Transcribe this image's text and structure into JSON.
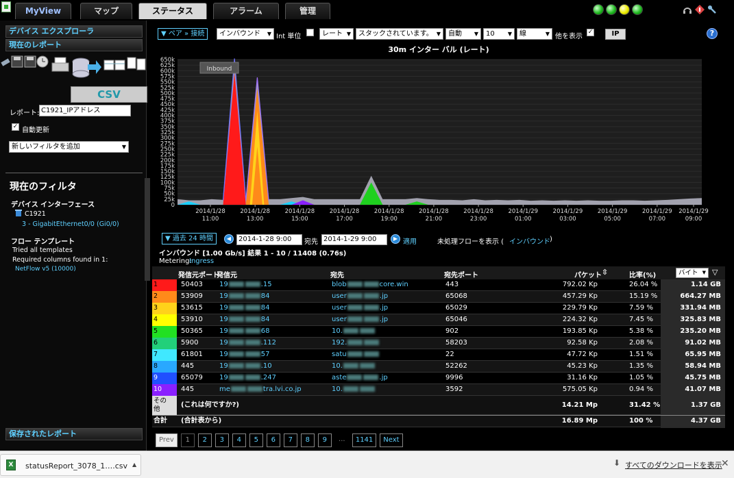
{
  "tabs": [
    {
      "label": "MyView"
    },
    {
      "label": "マップ"
    },
    {
      "label": "ステータス"
    },
    {
      "label": "アラーム"
    },
    {
      "label": "管理"
    }
  ],
  "sidebar": {
    "explorer_title": "デバイス エクスプローラ",
    "current_report_title": "現在のレポート",
    "csv_label": "CSV",
    "report_label": "レポート:",
    "report_value": "C1921_IPアドレス",
    "auto_update_label": "自動更新",
    "add_filter_label": "新しいフィルタを追加",
    "current_filter_title": "現在のフィルタ",
    "device_interface_title": "デバイス インターフェース",
    "device_name": "C1921",
    "interface_name": "3 - GigabitEthernet0/0 (Gi0/0)",
    "flow_template_title": "フロー テンプレート",
    "tried_templates": "Tried all templates",
    "required_columns": "Required columns found in 1:",
    "netflow_link": "NetFlow v5 (10000)",
    "saved_reports_title": "保存されたレポート"
  },
  "toolbar": {
    "pair_connection": "▼ ペア » 接続",
    "direction": "インバウンド",
    "int_unit_label": "Int 単位",
    "rate": "レート",
    "stacked": "スタックされています。",
    "auto": "自動",
    "count": "10",
    "line": "線",
    "show_others_label": "他を表示",
    "ip_label": "IP",
    "help_label": "?"
  },
  "chart_title": "30m インター バル (レート)",
  "chart_data": {
    "type": "area",
    "legend_badge": "Inbound",
    "ylim": [
      0,
      650000
    ],
    "y_ticks": [
      "0",
      "25k",
      "50k",
      "75k",
      "100k",
      "125k",
      "150k",
      "175k",
      "200k",
      "225k",
      "250k",
      "275k",
      "300k",
      "325k",
      "350k",
      "375k",
      "400k",
      "425k",
      "450k",
      "475k",
      "500k",
      "525k",
      "550k",
      "575k",
      "600k",
      "625k",
      "650k"
    ],
    "x_ticks": [
      {
        "date": "2014/1/28",
        "time": "11:00"
      },
      {
        "date": "2014/1/28",
        "time": "13:00"
      },
      {
        "date": "2014/1/28",
        "time": "15:00"
      },
      {
        "date": "2014/1/28",
        "time": "17:00"
      },
      {
        "date": "2014/1/28",
        "time": "19:00"
      },
      {
        "date": "2014/1/28",
        "time": "21:00"
      },
      {
        "date": "2014/1/28",
        "time": "23:00"
      },
      {
        "date": "2014/1/29",
        "time": "01:00"
      },
      {
        "date": "2014/1/29",
        "time": "03:00"
      },
      {
        "date": "2014/1/29",
        "time": "05:00"
      },
      {
        "date": "2014/1/29",
        "time": "07:00"
      },
      {
        "date": "2014/1/29",
        "time": "09:00"
      }
    ],
    "x": [
      "10:30",
      "11:00",
      "11:30",
      "12:00",
      "12:30",
      "13:00",
      "13:30",
      "14:00",
      "14:30",
      "15:00",
      "15:30",
      "16:00",
      "16:30",
      "17:00",
      "17:30",
      "18:00",
      "18:30",
      "19:00",
      "19:30",
      "20:00",
      "20:30",
      "21:00",
      "21:30",
      "22:00",
      "22:30",
      "23:00",
      "23:30",
      "00:00",
      "00:30",
      "01:00",
      "01:30",
      "02:00",
      "02:30",
      "03:00",
      "03:30",
      "04:00",
      "04:30",
      "05:00",
      "05:30",
      "06:00",
      "06:30",
      "07:00",
      "07:30",
      "08:00",
      "08:30",
      "09:00",
      "09:30"
    ],
    "series": [
      {
        "color": "#ff1a1a",
        "values": [
          0,
          0,
          0,
          0,
          0,
          590000,
          0,
          0,
          0,
          0,
          0,
          0,
          0,
          0,
          0,
          0,
          0,
          0,
          0,
          0,
          0,
          0,
          0,
          0,
          0,
          0,
          0,
          0,
          0,
          0,
          0,
          0,
          0,
          0,
          0,
          0,
          0,
          0,
          0,
          0,
          0,
          0,
          0,
          0,
          0,
          0,
          0
        ]
      },
      {
        "color": "#ff8a1a",
        "values": [
          0,
          0,
          0,
          0,
          0,
          0,
          0,
          520000,
          0,
          0,
          0,
          0,
          0,
          0,
          0,
          0,
          0,
          0,
          0,
          0,
          0,
          0,
          0,
          0,
          0,
          0,
          0,
          0,
          0,
          0,
          0,
          0,
          0,
          0,
          0,
          0,
          0,
          0,
          0,
          0,
          0,
          0,
          0,
          0,
          0,
          0,
          0
        ]
      },
      {
        "color": "#ffd21a",
        "values": [
          0,
          0,
          0,
          0,
          0,
          0,
          0,
          0,
          0,
          0,
          0,
          0,
          0,
          0,
          0,
          0,
          0,
          0,
          0,
          0,
          0,
          0,
          0,
          0,
          0,
          0,
          0,
          0,
          0,
          0,
          0,
          0,
          0,
          0,
          0,
          0,
          0,
          0,
          0,
          0,
          0,
          0,
          0,
          0,
          0,
          0,
          0
        ]
      },
      {
        "color": "#1fd01f",
        "values": [
          0,
          0,
          0,
          0,
          0,
          0,
          0,
          0,
          0,
          0,
          0,
          0,
          0,
          0,
          0,
          0,
          0,
          100000,
          0,
          0,
          0,
          15000,
          0,
          0,
          0,
          0,
          0,
          0,
          0,
          0,
          0,
          0,
          0,
          0,
          0,
          0,
          0,
          0,
          0,
          0,
          0,
          0,
          0,
          0,
          0,
          0,
          0
        ]
      },
      {
        "color": "#19d0ff",
        "values": [
          0,
          15000,
          0,
          0,
          0,
          0,
          0,
          0,
          0,
          0,
          15000,
          0,
          0,
          0,
          0,
          0,
          0,
          0,
          0,
          0,
          0,
          0,
          0,
          0,
          0,
          0,
          0,
          0,
          0,
          0,
          0,
          0,
          0,
          0,
          0,
          0,
          0,
          0,
          0,
          0,
          0,
          0,
          0,
          0,
          0,
          0,
          0
        ]
      },
      {
        "color": "#8a20ff",
        "values": [
          0,
          0,
          0,
          0,
          0,
          0,
          0,
          0,
          0,
          0,
          0,
          20000,
          0,
          0,
          0,
          0,
          0,
          0,
          0,
          0,
          0,
          0,
          0,
          0,
          0,
          0,
          0,
          0,
          0,
          0,
          0,
          0,
          0,
          0,
          0,
          0,
          0,
          0,
          0,
          0,
          0,
          0,
          0,
          0,
          0,
          0,
          0
        ]
      },
      {
        "color": "#b8b8c8",
        "values": [
          25000,
          20000,
          20000,
          25000,
          22000,
          655000,
          30000,
          570000,
          25000,
          25000,
          30000,
          35000,
          25000,
          25000,
          25000,
          25000,
          25000,
          130000,
          25000,
          25000,
          25000,
          30000,
          25000,
          22000,
          22000,
          20000,
          25000,
          20000,
          22000,
          20000,
          22000,
          18000,
          20000,
          18000,
          20000,
          18000,
          20000,
          18000,
          18000,
          20000,
          20000,
          18000,
          20000,
          22000,
          25000,
          28000,
          30000
        ]
      }
    ]
  },
  "controls": {
    "range_button": "▼ 過去 24 時間",
    "start_date": "2014-1-28 9:00",
    "dest_label": "宛先",
    "end_date": "2014-1-29 9:00",
    "apply_label": "適用",
    "unprocessed_label": "未処理フローを表示 (",
    "unprocessed_link": "インバウンド",
    "unprocessed_close": ")",
    "summary": "インバウンド [1.00 Gb/s] 結果 1 - 10 / 11408 (0.76s)",
    "metering_label": "Metering:",
    "metering_value": "Ingress"
  },
  "table": {
    "headers": {
      "src_port": "発信元ポート",
      "src": "発信元",
      "dest": "宛先",
      "dest_port": "宛先ポート",
      "packets": "パケット",
      "ratio": "比率(%)",
      "unit": "バイト"
    },
    "rows": [
      {
        "idx": "1",
        "color": "#ff1a1a",
        "src_port": "50403",
        "src_a": "19",
        "src_b": ".15",
        "dest_a": "blob",
        "dest_b": "core.win",
        "dest_port": "443",
        "packets": "792.02 Kp",
        "ratio": "26.04 %",
        "bytes": "1.14 GB"
      },
      {
        "idx": "2",
        "color": "#ff8a1a",
        "src_port": "53909",
        "src_a": "19",
        "src_b": "84",
        "dest_a": "user",
        "dest_b": ".jp",
        "dest_port": "65068",
        "packets": "457.29 Kp",
        "ratio": "15.19 %",
        "bytes": "664.27 MB"
      },
      {
        "idx": "3",
        "color": "#ffd21a",
        "src_port": "53615",
        "src_a": "19",
        "src_b": "84",
        "dest_a": "user",
        "dest_b": ".jp",
        "dest_port": "65029",
        "packets": "229.79 Kp",
        "ratio": "7.59 %",
        "bytes": "331.94 MB"
      },
      {
        "idx": "4",
        "color": "#ffff00",
        "src_port": "53910",
        "src_a": "19",
        "src_b": "84",
        "dest_a": "user",
        "dest_b": ".jp",
        "dest_port": "65046",
        "packets": "224.32 Kp",
        "ratio": "7.45 %",
        "bytes": "325.83 MB"
      },
      {
        "idx": "5",
        "color": "#22e022",
        "src_port": "50365",
        "src_a": "19",
        "src_b": "68",
        "dest_a": "10.",
        "dest_b": "",
        "dest_port": "902",
        "packets": "193.85 Kp",
        "ratio": "5.38 %",
        "bytes": "235.20 MB"
      },
      {
        "idx": "6",
        "color": "#22d07a",
        "src_port": "5900",
        "src_a": "19",
        "src_b": ".112",
        "dest_a": "192.",
        "dest_b": "",
        "dest_port": "58203",
        "packets": "92.58 Kp",
        "ratio": "2.08 %",
        "bytes": "91.02 MB"
      },
      {
        "idx": "7",
        "color": "#40e8ff",
        "src_port": "61801",
        "src_a": "19",
        "src_b": "57",
        "dest_a": "satu",
        "dest_b": "",
        "dest_port": "22",
        "packets": "47.72 Kp",
        "ratio": "1.51 %",
        "bytes": "65.95 MB"
      },
      {
        "idx": "8",
        "color": "#29a8ff",
        "src_port": "445",
        "src_a": "19",
        "src_b": ".10",
        "dest_a": "10.",
        "dest_b": "",
        "dest_port": "52262",
        "packets": "45.23 Kp",
        "ratio": "1.35 %",
        "bytes": "58.94 MB"
      },
      {
        "idx": "9",
        "color": "#2050ff",
        "src_port": "65079",
        "src_a": "19",
        "src_b": ".247",
        "dest_a": "aste",
        "dest_b": ".jp",
        "dest_port": "9996",
        "packets": "31.16 Kp",
        "ratio": "1.05 %",
        "bytes": "45.75 MB"
      },
      {
        "idx": "10",
        "color": "#8a20ff",
        "src_port": "445",
        "src_a": "me",
        "src_b": "tra.lvi.co.jp",
        "dest_a": "10.",
        "dest_b": "",
        "dest_port": "3592",
        "packets": "575.05 Kp",
        "ratio": "0.94 %",
        "bytes": "41.07 MB"
      }
    ],
    "other": {
      "idx_top": "その",
      "idx_bottom": "他",
      "label": "(これは何ですか?)",
      "packets": "14.21 Mp",
      "ratio": "31.42 %",
      "bytes": "1.37 GB"
    },
    "total": {
      "label": "合計",
      "sub": "(合計表から)",
      "packets": "16.89 Mp",
      "ratio": "100 %",
      "bytes": "4.37 GB"
    }
  },
  "pager": {
    "prev": "Prev",
    "pages": [
      "1",
      "2",
      "3",
      "4",
      "5",
      "6",
      "7",
      "8",
      "9"
    ],
    "ellipsis": "...",
    "last": "1141",
    "next": "Next"
  },
  "download_bar": {
    "file_name": "statusReport_3078_1….csv",
    "show_all": "すべてのダウンロードを表示"
  }
}
